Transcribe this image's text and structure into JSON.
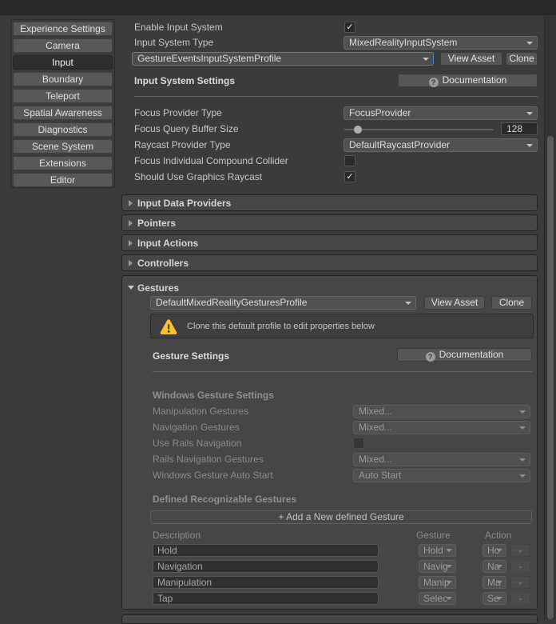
{
  "colors": {
    "focus_border": "#4284D4",
    "warning_yellow": "#FFC128",
    "background": "#3B3B3B"
  },
  "sidebar": {
    "items": [
      {
        "label": "Experience Settings",
        "active": false
      },
      {
        "label": "Camera",
        "active": false
      },
      {
        "label": "Input",
        "active": true
      },
      {
        "label": "Boundary",
        "active": false
      },
      {
        "label": "Teleport",
        "active": false
      },
      {
        "label": "Spatial Awareness",
        "active": false
      },
      {
        "label": "Diagnostics",
        "active": false
      },
      {
        "label": "Scene System",
        "active": false
      },
      {
        "label": "Extensions",
        "active": false
      },
      {
        "label": "Editor",
        "active": false
      }
    ]
  },
  "main": {
    "enable_row": {
      "label": "Enable Input System",
      "checked": true
    },
    "type_row": {
      "label": "Input System Type",
      "value": "MixedRealityInputSystem"
    },
    "profile_row": {
      "value": "GestureEventsInputSystemProfile",
      "view_asset": "View Asset",
      "clone": "Clone"
    },
    "settings_header": {
      "title": "Input System Settings",
      "documentation": "Documentation",
      "help_glyph": "?"
    },
    "focus_provider_row": {
      "label": "Focus Provider Type",
      "value": "FocusProvider"
    },
    "buffer_row": {
      "label": "Focus Query Buffer Size",
      "value": "128"
    },
    "raycast_row": {
      "label": "Raycast Provider Type",
      "value": "DefaultRaycastProvider"
    },
    "collider_row": {
      "label": "Focus Individual Compound Collider",
      "checked": false
    },
    "graphics_row": {
      "label": "Should Use Graphics Raycast",
      "checked": true
    },
    "sections": [
      {
        "label": "Input Data Providers"
      },
      {
        "label": "Pointers"
      },
      {
        "label": "Input Actions"
      },
      {
        "label": "Controllers"
      }
    ],
    "gestures": {
      "title": "Gestures",
      "profile": {
        "value": "DefaultMixedRealityGesturesProfile",
        "view_asset": "View Asset",
        "clone": "Clone"
      },
      "warning": "Clone this default profile to edit properties below",
      "header": {
        "title": "Gesture Settings",
        "documentation": "Documentation",
        "help_glyph": "?"
      },
      "windows_title": "Windows Gesture Settings",
      "manipulation_row": {
        "label": "Manipulation Gestures",
        "value": "Mixed..."
      },
      "navigation_row": {
        "label": "Navigation Gestures",
        "value": "Mixed..."
      },
      "rails_row": {
        "label": "Use Rails Navigation",
        "checked": false
      },
      "rails_gestures_row": {
        "label": "Rails Navigation Gestures",
        "value": "Mixed..."
      },
      "auto_start_row": {
        "label": "Windows Gesture Auto Start",
        "value": "Auto Start"
      },
      "defined_title": "Defined Recognizable Gestures",
      "add_button": "+ Add a New defined Gesture",
      "table": {
        "headers": [
          "Description",
          "Gesture",
          "Action"
        ],
        "rows": [
          {
            "description": "Hold",
            "gesture": "Hold",
            "action": "Ho",
            "remove": "-"
          },
          {
            "description": "Navigation",
            "gesture": "Navig",
            "action": "Na",
            "remove": "-"
          },
          {
            "description": "Manipulation",
            "gesture": "Manip",
            "action": "Ma",
            "remove": "-"
          },
          {
            "description": "Tap",
            "gesture": "Selec",
            "action": "Se",
            "remove": "-"
          }
        ]
      }
    }
  }
}
